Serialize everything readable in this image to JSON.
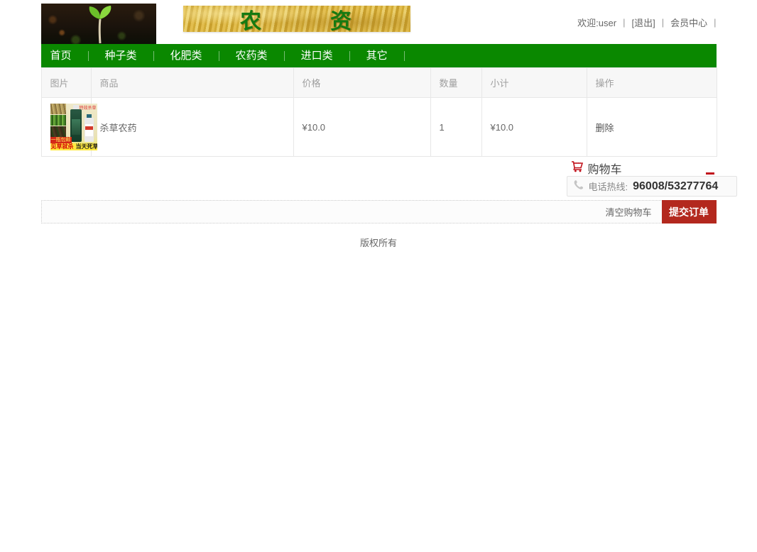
{
  "header": {
    "banner": {
      "char_left": "农",
      "char_right": "资"
    },
    "user_bar": {
      "welcome": "欢迎:user",
      "sep": "|",
      "logout": "[退出]",
      "member_center": "会员中心"
    }
  },
  "nav": {
    "items": [
      {
        "label": "首页"
      },
      {
        "label": "种子类"
      },
      {
        "label": "化肥类"
      },
      {
        "label": "农药类"
      },
      {
        "label": "进口类"
      },
      {
        "label": "其它"
      }
    ]
  },
  "cart_table": {
    "columns": [
      "图片",
      "商品",
      "价格",
      "数量",
      "小计",
      "操作"
    ],
    "rows": [
      {
        "product": "杀草农药",
        "price": "¥10.0",
        "quantity": "1",
        "subtotal": "¥10.0",
        "action": "删除",
        "thumb": {
          "badge": "一瓶包邮",
          "slogan_red": "见草就杀",
          "slogan_dark": "当天死草",
          "top_red": "特效杀草"
        }
      }
    ]
  },
  "cart_panel": {
    "title": "购物车",
    "hotline_label": "电话热线:",
    "hotline_number": "96008/53277764"
  },
  "actions": {
    "clear_cart": "清空购物车",
    "submit_order": "提交订单"
  },
  "footer": {
    "copyright": "版权所有"
  },
  "colors": {
    "nav_green": "#0a8800",
    "banner_text_green": "#157a12",
    "button_red": "#b3281e",
    "icon_red": "#c1121c"
  }
}
